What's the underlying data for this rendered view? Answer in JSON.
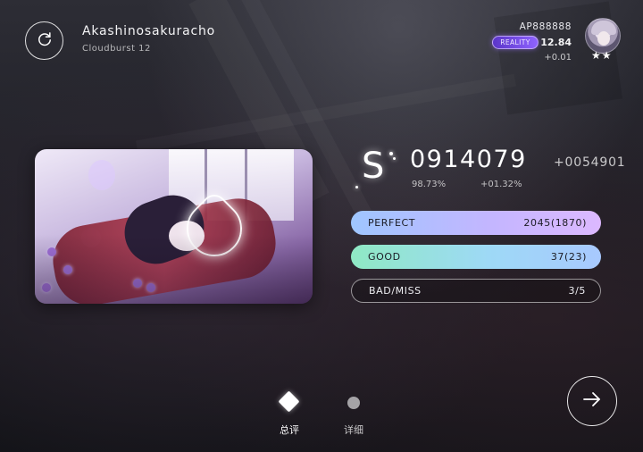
{
  "song": {
    "title": "Akashinosakuracho",
    "chart": "Cloudburst 12"
  },
  "player": {
    "name": "AP888888",
    "badge": "REALITY",
    "rks": "12.84",
    "rks_delta": "+0.01",
    "stars": "★★"
  },
  "result": {
    "grade": "S",
    "score": "0914079",
    "score_delta": "+0054901",
    "accuracy": "98.73%",
    "accuracy_delta": "+01.32%"
  },
  "judgements": [
    {
      "label": "PERFECT",
      "value": "2045(1870)"
    },
    {
      "label": "GOOD",
      "value": "37(23)"
    },
    {
      "label": "BAD/MISS",
      "value": "3/5"
    }
  ],
  "tabs": [
    {
      "label": "总评",
      "active": true
    },
    {
      "label": "详细",
      "active": false
    }
  ],
  "icons": {
    "retry": "retry-icon",
    "next": "arrow-right-icon"
  },
  "colors": {
    "perfect_bar_start": "#9fc6ff",
    "perfect_bar_end": "#dcb8ff",
    "good_bar_start": "#8fe9c4",
    "good_bar_end": "#a8c9ff",
    "badge": "#7b52ef"
  }
}
